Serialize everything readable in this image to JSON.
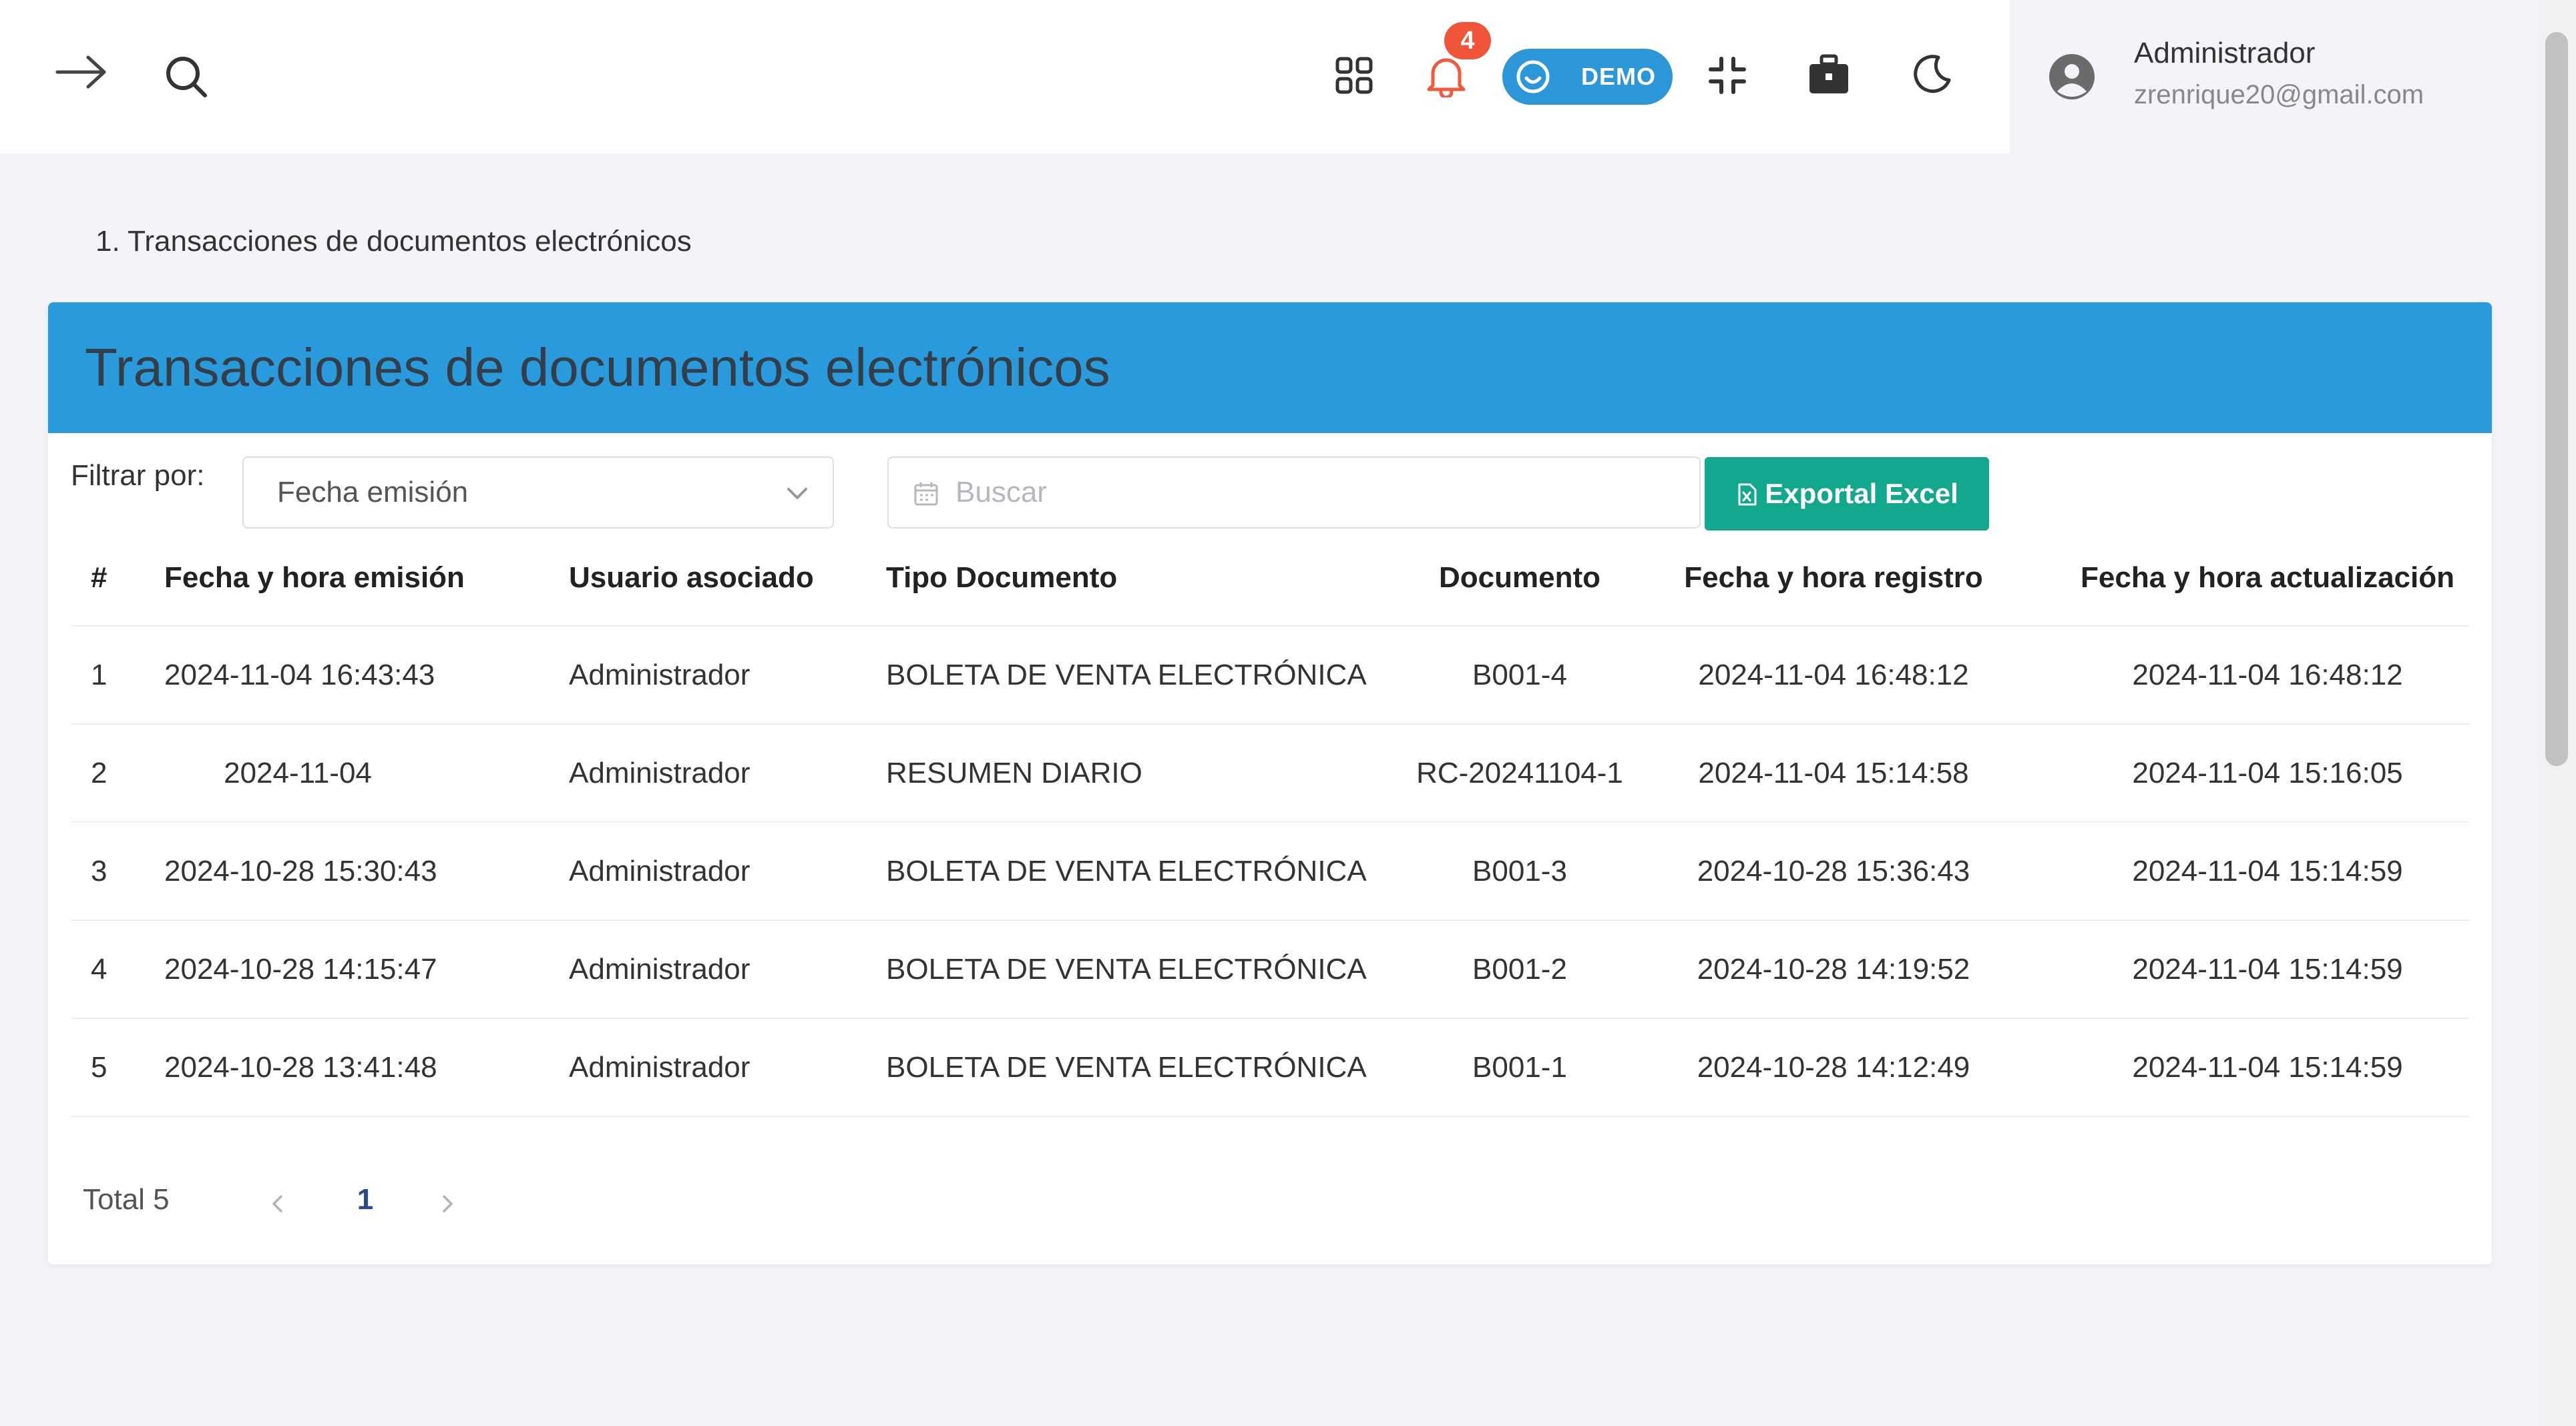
{
  "header": {
    "notifications_count": "4",
    "demo_label": "DEMO",
    "user": {
      "name": "Administrador",
      "email": "zrenrique20@gmail.com"
    },
    "icons": [
      "arrow-right-icon",
      "search-icon",
      "grid-apps-icon",
      "bell-icon",
      "smile-icon",
      "compress-icon",
      "briefcase-icon",
      "moon-icon",
      "user-avatar-icon"
    ]
  },
  "breadcrumb": "1. Transacciones de documentos electrónicos",
  "card": {
    "title": "Transacciones de documentos electrónicos",
    "filter_label": "Filtrar por:",
    "filter_select_value": "Fecha emisión",
    "search_placeholder": "Buscar",
    "export_label": "Exportal Excel"
  },
  "table": {
    "columns": [
      "#",
      "Fecha y hora emisión",
      "Usuario asociado",
      "Tipo Documento",
      "Documento",
      "Fecha y hora registro",
      "Fecha y hora actualización"
    ],
    "rows": [
      [
        "1",
        "2024-11-04 16:43:43",
        "Administrador",
        "BOLETA DE VENTA ELECTRÓNICA",
        "B001-4",
        "2024-11-04 16:48:12",
        "2024-11-04 16:48:12"
      ],
      [
        "2",
        "2024-11-04",
        "Administrador",
        "RESUMEN DIARIO",
        "RC-20241104-1",
        "2024-11-04 15:14:58",
        "2024-11-04 15:16:05"
      ],
      [
        "3",
        "2024-10-28 15:30:43",
        "Administrador",
        "BOLETA DE VENTA ELECTRÓNICA",
        "B001-3",
        "2024-10-28 15:36:43",
        "2024-11-04 15:14:59"
      ],
      [
        "4",
        "2024-10-28 14:15:47",
        "Administrador",
        "BOLETA DE VENTA ELECTRÓNICA",
        "B001-2",
        "2024-10-28 14:19:52",
        "2024-11-04 15:14:59"
      ],
      [
        "5",
        "2024-10-28 13:41:48",
        "Administrador",
        "BOLETA DE VENTA ELECTRÓNICA",
        "B001-1",
        "2024-10-28 14:12:49",
        "2024-11-04 15:14:59"
      ]
    ]
  },
  "pagination": {
    "total_label": "Total 5",
    "current_page": "1"
  },
  "colors": {
    "header_blue": "#299bdc",
    "demo_blue": "#2b96d8",
    "export_green": "#11a88e",
    "badge_red": "#f0553a",
    "page_active": "#2a4b8d"
  }
}
